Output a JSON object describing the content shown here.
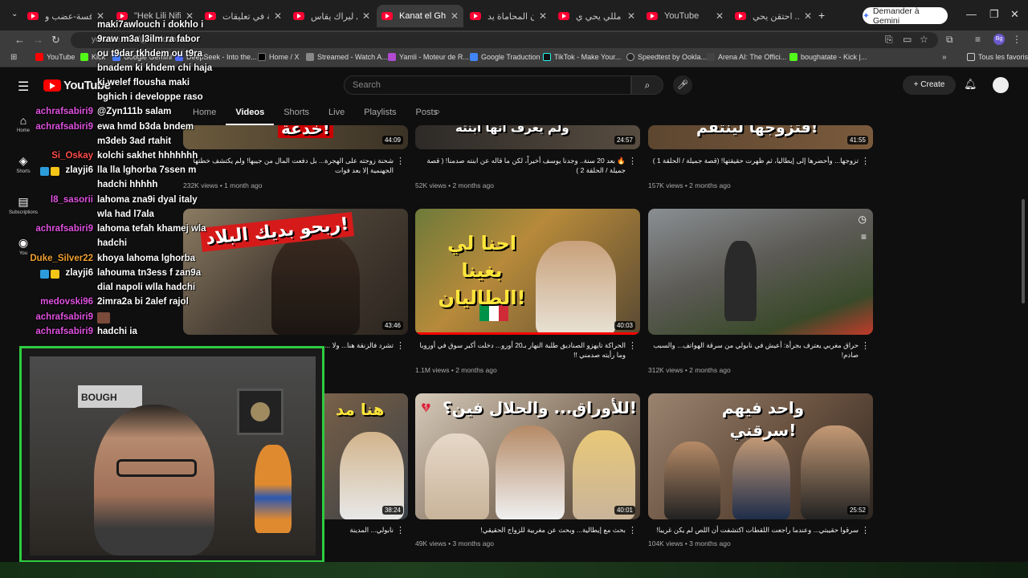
{
  "browser": {
    "tabs": [
      {
        "label": "المكافسة-عضب و",
        "active": false
      },
      {
        "label": "\"Hek Lili Nifi...",
        "active": false
      },
      {
        "label": "جولة في تعليقات",
        "active": false
      },
      {
        "label": "حي ليراك يقاس -",
        "active": false
      },
      {
        "label": "Kanat el Ghorba",
        "active": true
      },
      {
        "label": "قانون المحاماة يد",
        "active": false
      },
      {
        "label": "شاب مللي يحي ي",
        "active": false
      },
      {
        "label": "YouTube",
        "active": false
      },
      {
        "label": "فاس.. احتقن يحي",
        "active": false
      }
    ],
    "gemini_label": "Demander à Gemini",
    "url": "youtube.com/@.../videos",
    "bookmarks": [
      "YouTube",
      "Kick",
      "Google Gemini",
      "DeepSeek - Into the...",
      "Home / X",
      "Streamed - Watch A...",
      "Yamli - Moteur de R...",
      "Google Traduction",
      "TikTok - Make Your...",
      "Speedtest by Ookla...",
      "Arena AI: The Offici...",
      "boughatate - Kick |..."
    ],
    "all_favorites": "Tous les favoris"
  },
  "youtube": {
    "search_placeholder": "Search",
    "create_label": "Create",
    "rail": [
      {
        "icon": "⌂",
        "label": "Home"
      },
      {
        "icon": "◈",
        "label": "Shorts"
      },
      {
        "icon": "▤",
        "label": "Subscriptions"
      },
      {
        "icon": "◉",
        "label": "You"
      }
    ],
    "channel_tabs": [
      {
        "label": "Home",
        "active": false
      },
      {
        "label": "Videos",
        "active": true
      },
      {
        "label": "Shorts",
        "active": false
      },
      {
        "label": "Live",
        "active": false
      },
      {
        "label": "Playlists",
        "active": false
      },
      {
        "label": "Posts",
        "active": false
      }
    ],
    "videos": [
      {
        "thumb_text": "خدعة!",
        "duration": "44:09",
        "title": "شحنة زوجته على الهجرة... بل دفعت المال من جيبها! ولم يكتشف خطتها الجهنمية إلا بعد فوات",
        "meta": "232K views • 1 month ago"
      },
      {
        "thumb_text": "ولم يعرف أنها ابنته",
        "duration": "24:57",
        "title": "🔥 بعد 20 سنة.. وجدنا يوسف أخيراً، لكن ما قاله عن ابنته صدمنا! ( قصة جميلة / الحلقة 2 )",
        "meta": "52K views • 2 months ago"
      },
      {
        "thumb_text": "فتزوجها لينتقم!",
        "duration": "41:55",
        "title": "تزوجها... وأحضرها إلى إيطاليا، ثم ظهرت حقيقتها! (قصة جميلة / الحلقة 1 )",
        "meta": "157K views • 2 months ago"
      },
      {
        "thumb_text": "ربحو بديك البلاد!",
        "duration": "43:46",
        "title": "تشرد فالزنقة هنا... ولا ...",
        "meta": ""
      },
      {
        "thumb_text": "احنا لي بغينا الطاليان!",
        "duration": "40:03",
        "title": "الحراكة تايهزو الصناديق طلبة النهار بـ20 أورو... دخلت أكبر سوق في أوروبا وما رأيته صدمني !!",
        "meta": "1.1M views • 2 months ago"
      },
      {
        "thumb_text": "",
        "duration": "",
        "title": "حراق مغربي يعترف بجرأة: أعيش في نابولي من سرقة الهواتف... والسبب صادم!",
        "meta": "312K views • 2 months ago"
      },
      {
        "thumb_text": "هنا مد",
        "duration": "38:24",
        "title": "نابولي... المدينة",
        "meta": ""
      },
      {
        "thumb_text": "للأوراق... والحلال فين؟!",
        "duration": "40:01",
        "title": "بحث مع إيطالية... وبحث عن مغربية للزواج الحقيقي!",
        "meta": "49K views • 3 months ago"
      },
      {
        "thumb_text": "واحد فيهم سرقني!",
        "duration": "25:52",
        "title": "سرقوا حقيبتي... وعندما راجعت اللقطات اكتشفت أن اللص لم يكن غريبا!",
        "meta": "104K views • 3 months ago"
      }
    ]
  },
  "stream_chat": [
    {
      "user": "",
      "msg": "maki7awlouch i dokhlo i",
      "color": "#ffffff"
    },
    {
      "user": "",
      "msg": "9raw m3a l3ilm ra fabor",
      "color": "#ffffff"
    },
    {
      "user": "",
      "msg": "ou t9dar tkhdem ou t9ra",
      "color": "#ffffff"
    },
    {
      "user": "",
      "msg": "bnadem ki khdem chi haja",
      "color": "#ffffff"
    },
    {
      "user": "",
      "msg": "ki welef flousha maki",
      "color": "#ffffff"
    },
    {
      "user": "",
      "msg": "bghich i developpe raso",
      "color": "#ffffff"
    },
    {
      "user": "achrafsabiri9",
      "msg": "@Zyn111b salam",
      "color": "#e052e0"
    },
    {
      "user": "achrafsabiri9",
      "msg": "ewa hmd b3da bndem",
      "color": "#e052e0"
    },
    {
      "user": "",
      "msg": "m3deb 3ad rtahit",
      "color": "#ffffff"
    },
    {
      "user": "Si_Oskay",
      "msg": "kolchi sakhet hhhhhhh",
      "color": "#ff4d4d"
    },
    {
      "user": "zlayji6",
      "msg": "lla lla lghorba 7ssen m",
      "color": "#ffffff"
    },
    {
      "user": "",
      "msg": "hadchi hhhhh",
      "color": "#ffffff"
    },
    {
      "user": "l8_sasorii",
      "msg": "lahoma zna9i dyal italy",
      "color": "#e052e0"
    },
    {
      "user": "",
      "msg": "wla had l7ala",
      "color": "#ffffff"
    },
    {
      "user": "achrafsabiri9",
      "msg": "lahoma tefah khamej wla",
      "color": "#e052e0"
    },
    {
      "user": "",
      "msg": "hadchi",
      "color": "#ffffff"
    },
    {
      "user": "Duke_Silver22",
      "msg": "khoya lahoma lghorba",
      "color": "#f0a030"
    },
    {
      "user": "zlayji6",
      "msg": "lahouma tn3ess f zan9a",
      "color": "#ffffff"
    },
    {
      "user": "",
      "msg": "dial napoli wlla hadchi",
      "color": "#ffffff"
    },
    {
      "user": "medovski96",
      "msg": "2imra2a bi 2alef rajol",
      "color": "#e052e0"
    },
    {
      "user": "achrafsabiri9",
      "msg": "",
      "color": "#e052e0"
    },
    {
      "user": "achrafsabiri9",
      "msg": "hadchi ia",
      "color": "#e052e0"
    }
  ],
  "webcam_sign": "BOUGH"
}
